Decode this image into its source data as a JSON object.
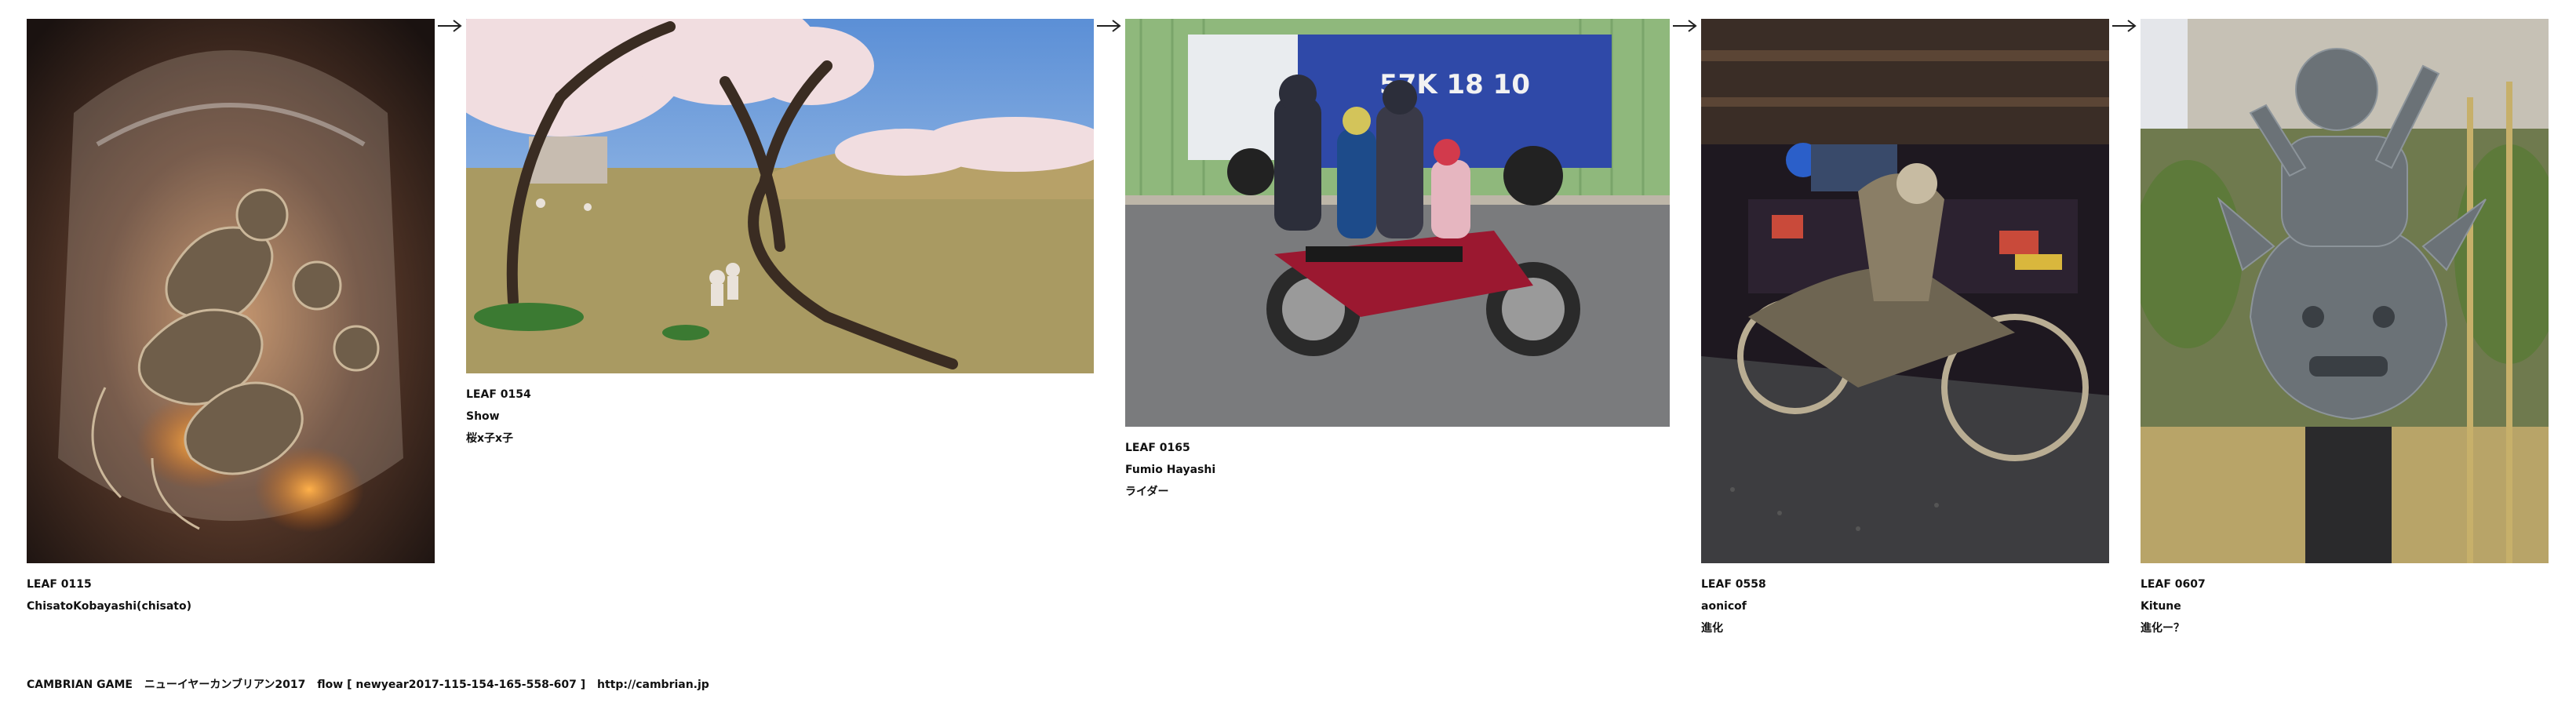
{
  "leaves": [
    {
      "number": "LEAF 0115",
      "author": "ChisatoKobayashi(chisato)",
      "title": "",
      "photo": "glass-bottle-monkeys-photo"
    },
    {
      "number": "LEAF 0154",
      "author": "Show",
      "title": "桜x子x子",
      "photo": "cherry-blossom-park-photo"
    },
    {
      "number": "LEAF 0165",
      "author": "Fumio Hayashi",
      "title": "ライダー",
      "photo": "family-on-motorbike-photo"
    },
    {
      "number": "LEAF 0558",
      "author": "aonicof",
      "title": "進化",
      "photo": "skeleton-motorcycle-photo"
    },
    {
      "number": "LEAF 0607",
      "author": "Kitune",
      "title": "進化ー？",
      "photo": "bronze-statue-photo"
    }
  ],
  "truck_plate": "57K 18 10",
  "footer": {
    "game": "CAMBRIAN GAME",
    "event": "ニューイヤーカンブリアン2017",
    "flow": "flow [ newyear2017-115-154-165-558-607 ]",
    "url": "http://cambrian.jp"
  },
  "arrow_icon": "right-arrow-icon"
}
